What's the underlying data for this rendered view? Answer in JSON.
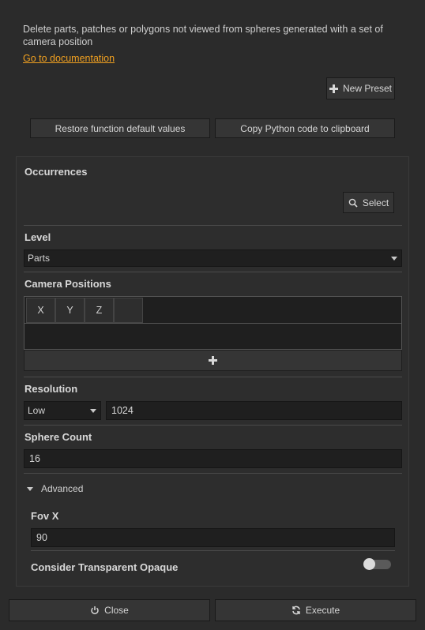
{
  "description": "Delete parts, patches or polygons not viewed from spheres generated with a set of camera position",
  "doc_link": "Go to documentation",
  "toolbar": {
    "new_preset": "New Preset",
    "restore_defaults": "Restore function default values",
    "copy_python": "Copy Python code to clipboard"
  },
  "occurrences": {
    "title": "Occurrences",
    "select_label": "Select"
  },
  "level": {
    "title": "Level",
    "value": "Parts"
  },
  "camera_positions": {
    "title": "Camera Positions",
    "columns": [
      "X",
      "Y",
      "Z",
      ""
    ]
  },
  "resolution": {
    "title": "Resolution",
    "mode": "Low",
    "value": "1024"
  },
  "sphere_count": {
    "title": "Sphere Count",
    "value": "16"
  },
  "advanced": {
    "label": "Advanced",
    "fov_x": {
      "title": "Fov X",
      "value": "90"
    },
    "consider_transparent_opaque": {
      "title": "Consider Transparent Opaque",
      "enabled": false
    }
  },
  "footer": {
    "close_label": "Close",
    "execute_label": "Execute"
  }
}
